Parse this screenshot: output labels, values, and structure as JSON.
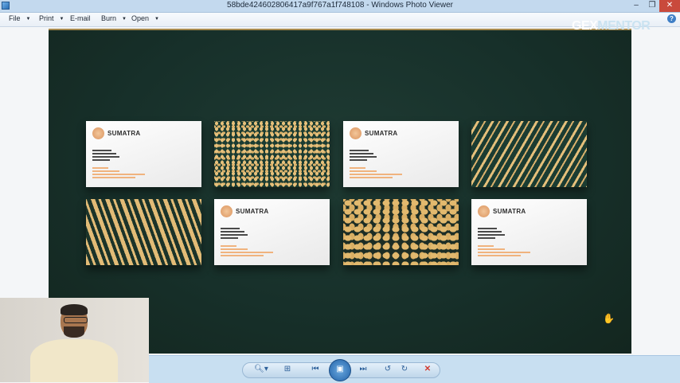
{
  "window": {
    "title": "58bde424602806417a9f767a1f748108 - Windows Photo Viewer",
    "minimize_glyph": "–",
    "maximize_glyph": "❐",
    "close_glyph": "✕"
  },
  "menu": {
    "items": [
      "File",
      "Print",
      "E-mail",
      "Burn",
      "Open"
    ],
    "help_glyph": "?"
  },
  "watermark": {
    "part1": "GEX",
    "part2": "MENTOR"
  },
  "photo": {
    "card_brand": "SUMATRA",
    "cards": [
      {
        "kind": "white"
      },
      {
        "kind": "leopard"
      },
      {
        "kind": "white"
      },
      {
        "kind": "zebra-diag"
      },
      {
        "kind": "zebra"
      },
      {
        "kind": "white"
      },
      {
        "kind": "giraffe"
      },
      {
        "kind": "white"
      }
    ],
    "colors": {
      "background": "#17302a",
      "gold": "#e4bf7a",
      "accent": "#f0b37e"
    }
  },
  "toolbar": {
    "zoom_glyph": "🔍︎▾",
    "actual_size_glyph": "⊞",
    "prev_glyph": "⏮",
    "slideshow_glyph": "▣",
    "next_glyph": "⏭",
    "rotate_ccw_glyph": "↺",
    "rotate_cw_glyph": "↻",
    "delete_glyph": "✕"
  },
  "cursor_glyph": "✋"
}
